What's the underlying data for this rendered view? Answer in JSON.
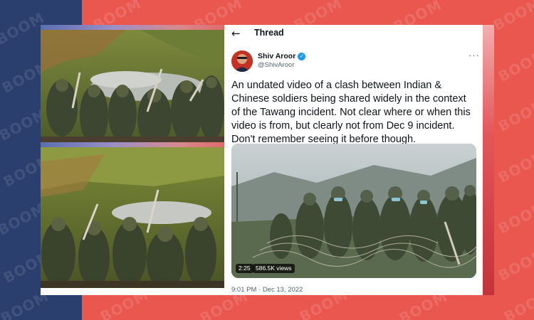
{
  "watermark": "BOOM",
  "thread": {
    "title": "Thread",
    "back_icon": "arrow-left-icon",
    "more_icon": "more-horizontal-icon"
  },
  "author": {
    "name": "Shiv Aroor",
    "handle": "@ShivAroor",
    "verified_icon": "verified-check-icon"
  },
  "tweet": {
    "text": "An undated video of a clash between Indian & Chinese soldiers being shared widely in the context of the Tawang incident. Not clear where or when this video is from, but clearly not from Dec 9 incident. Don't remember seeing it before though. OSINT/Experts?",
    "timestamp": "9:01 PM · Dec 13, 2022"
  },
  "video": {
    "duration": "2:25",
    "views": "586.5K views"
  },
  "colors": {
    "brand_blue": "#2b3f6e",
    "brand_red": "#e9574f",
    "verified": "#1d9bf0",
    "text_primary": "#0f1419",
    "text_secondary": "#536471"
  }
}
